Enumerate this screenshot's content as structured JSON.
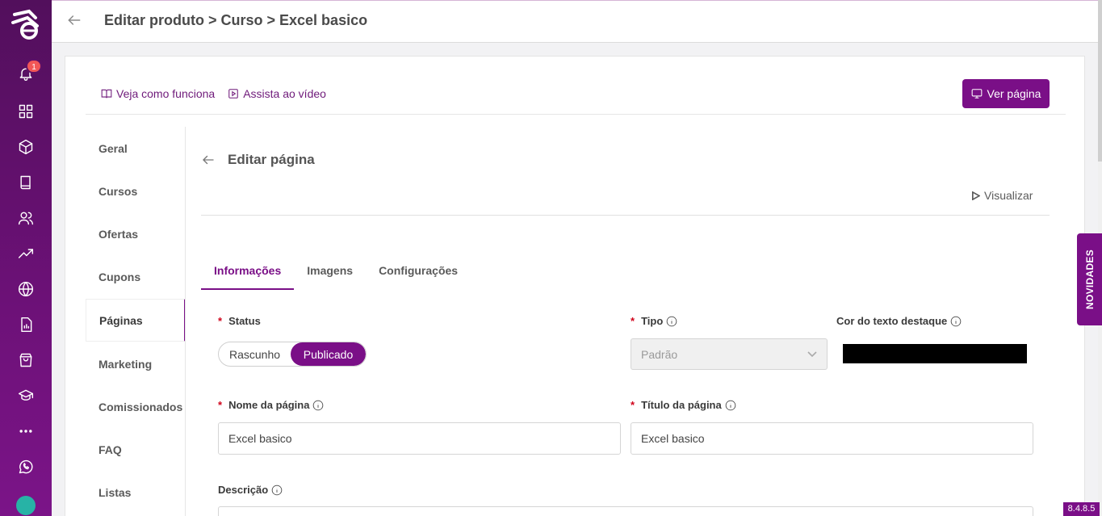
{
  "topbar": {
    "title": "Editar produto > Curso > Excel basico"
  },
  "sidebar": {
    "notification_count": "1",
    "icons": [
      "bell-icon",
      "grid-icon",
      "box-icon",
      "book-icon",
      "users-icon",
      "trending-icon",
      "globe-icon",
      "report-icon",
      "bag-icon",
      "graduation-icon",
      "more-icon",
      "whatsapp-icon"
    ]
  },
  "help": {
    "how_it_works": "Veja como funciona",
    "watch_video": "Assista ao vídeo"
  },
  "header_button": "Ver página",
  "product_menu": [
    {
      "label": "Geral"
    },
    {
      "label": "Cursos"
    },
    {
      "label": "Ofertas"
    },
    {
      "label": "Cupons"
    },
    {
      "label": "Páginas",
      "active": true
    },
    {
      "label": "Marketing"
    },
    {
      "label": "Comissionados"
    },
    {
      "label": "FAQ"
    },
    {
      "label": "Listas"
    }
  ],
  "edit_page": {
    "title": "Editar página",
    "preview": "Visualizar",
    "tabs": [
      "Informações",
      "Imagens",
      "Configurações"
    ],
    "active_tab": "Informações"
  },
  "form": {
    "status_label": "Status",
    "status_options": [
      "Rascunho",
      "Publicado"
    ],
    "status_value": "Publicado",
    "tipo_label": "Tipo",
    "tipo_value": "Padrão",
    "highlight_color_label": "Cor do texto destaque",
    "highlight_color": "#000000",
    "page_name_label": "Nome da página",
    "page_name_value": "Excel basico",
    "page_title_label": "Título da página",
    "page_title_value": "Excel basico",
    "description_label": "Descrição"
  },
  "novidades": "NOVIDADES",
  "version": "8.4.8.5",
  "colors": {
    "brand": "#7a0f87",
    "sidebar": "#5c1066",
    "required": "#d0021b"
  }
}
